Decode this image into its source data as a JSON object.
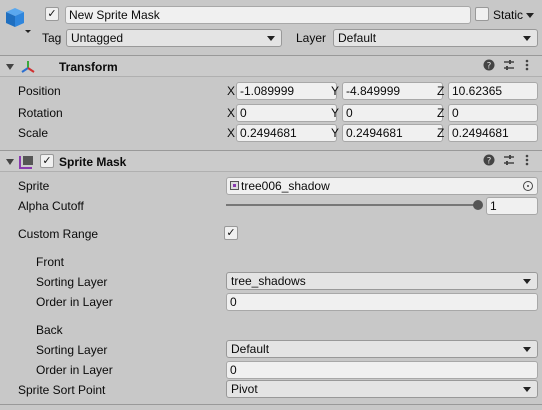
{
  "object": {
    "active_checked": true,
    "name": "New Sprite Mask",
    "static_label": "Static",
    "tag_label": "Tag",
    "tag_value": "Untagged",
    "layer_label": "Layer",
    "layer_value": "Default"
  },
  "transform": {
    "title": "Transform",
    "position_label": "Position",
    "rotation_label": "Rotation",
    "scale_label": "Scale",
    "axis_x": "X",
    "axis_y": "Y",
    "axis_z": "Z",
    "position": {
      "x": "-1.089999",
      "y": "-4.849999",
      "z": "10.62365"
    },
    "rotation": {
      "x": "0",
      "y": "0",
      "z": "0"
    },
    "scale": {
      "x": "0.2494681",
      "y": "0.2494681",
      "z": "0.2494681"
    }
  },
  "sprite_mask": {
    "title": "Sprite Mask",
    "enabled": true,
    "sprite_label": "Sprite",
    "sprite_value": "tree006_shadow",
    "alpha_cutoff_label": "Alpha Cutoff",
    "alpha_cutoff_value": "1",
    "alpha_cutoff_fraction": 1,
    "custom_range_label": "Custom Range",
    "custom_range_checked": true,
    "front_label": "Front",
    "front_sorting_layer_label": "Sorting Layer",
    "front_sorting_layer_value": "tree_shadows",
    "front_order_label": "Order in Layer",
    "front_order_value": "0",
    "back_label": "Back",
    "back_sorting_layer_label": "Sorting Layer",
    "back_sorting_layer_value": "Default",
    "back_order_label": "Order in Layer",
    "back_order_value": "0",
    "sort_point_label": "Sprite Sort Point",
    "sort_point_value": "Pivot"
  },
  "icons": {
    "help": "help-icon",
    "presets": "presets-icon",
    "menu": "kebab-menu-icon"
  },
  "colors": {
    "background": "#c8c8c8",
    "field": "#f0f0f0",
    "cube_icon": "#2f7fd0"
  }
}
